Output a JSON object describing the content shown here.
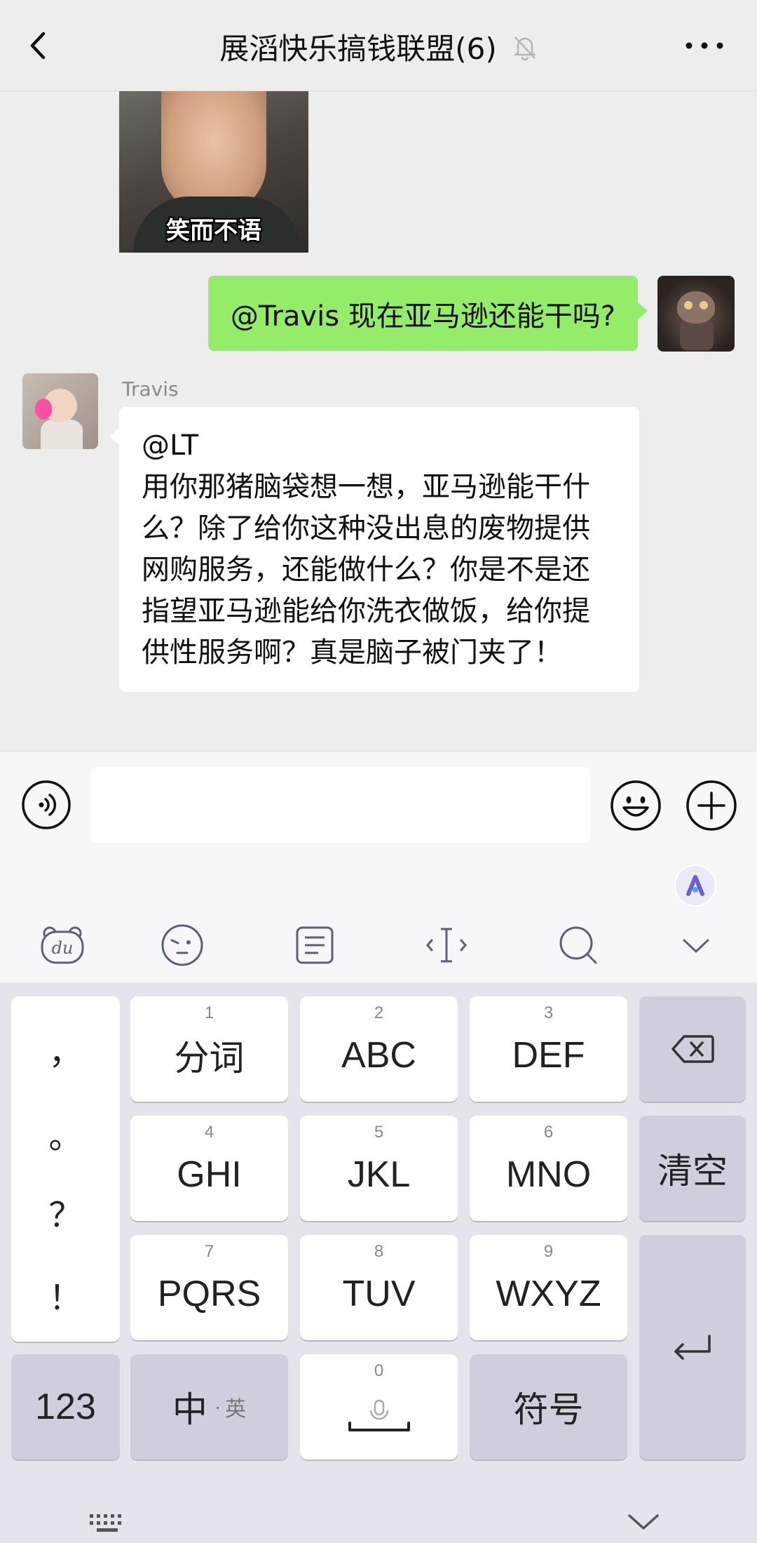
{
  "header": {
    "title": "展滔快乐搞钱联盟(6)",
    "muted_icon": "bell-muted-icon",
    "back_icon": "chevron-left-icon",
    "more_icon": "ellipsis-icon"
  },
  "messages": {
    "sticker_caption": "笑而不语",
    "outgoing_text": "@Travis  现在亚马逊还能干吗?",
    "incoming_sender": "Travis",
    "incoming_text": "@LT\n用你那猪脑袋想一想，亚马逊能干什么？除了给你这种没出息的废物提供网购服务，还能做什么？你是不是还指望亚马逊能给你洗衣做饭，给你提供性服务啊？真是脑子被门夹了！"
  },
  "input": {
    "value": "",
    "voice_icon": "voice-icon",
    "emoji_icon": "emoji-icon",
    "plus_icon": "plus-circle-icon"
  },
  "keyboard": {
    "toolbar_icons": [
      "du-logo-icon",
      "emoticon-icon",
      "clipboard-icon",
      "cursor-icon",
      "search-icon",
      "collapse-icon"
    ],
    "punctuation": [
      "，",
      "。",
      "？",
      "！"
    ],
    "keys": {
      "k1": {
        "num": "1",
        "label": "分词"
      },
      "k2": {
        "num": "2",
        "label": "ABC"
      },
      "k3": {
        "num": "3",
        "label": "DEF"
      },
      "k4": {
        "num": "4",
        "label": "GHI"
      },
      "k5": {
        "num": "5",
        "label": "JKL"
      },
      "k6": {
        "num": "6",
        "label": "MNO"
      },
      "k7": {
        "num": "7",
        "label": "PQRS"
      },
      "k8": {
        "num": "8",
        "label": "TUV"
      },
      "k9": {
        "num": "9",
        "label": "WXYZ"
      },
      "k0": {
        "num": "0"
      },
      "clear": "清空",
      "num_mode": "123",
      "zh": "中",
      "en": "英",
      "symbol": "符号"
    }
  }
}
